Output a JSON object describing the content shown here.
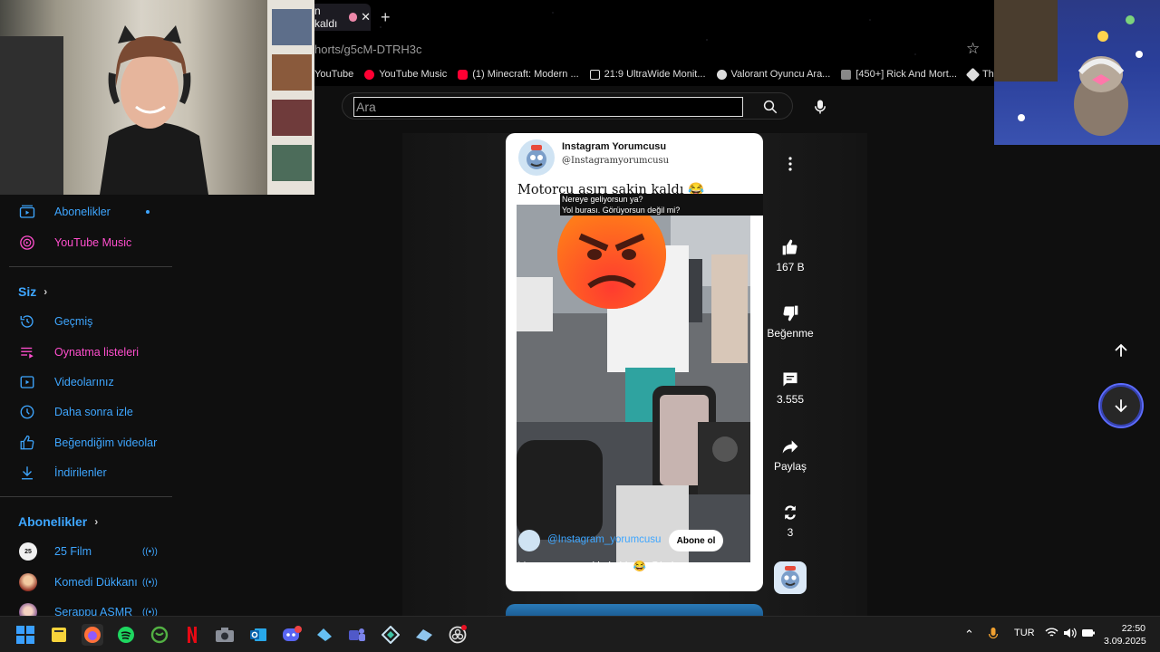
{
  "browser": {
    "tab_title": "n kaldı",
    "tab_close": "✕",
    "new_tab": "+",
    "url": "horts/g5cM-DTRH3c",
    "bookmarks": [
      {
        "label": "YouTube",
        "color": "#000000"
      },
      {
        "label": "YouTube Music",
        "color": "#ff0033"
      },
      {
        "label": "(1) Minecraft: Modern ...",
        "color": "#ff0033"
      },
      {
        "label": "21:9 UltraWide Monit...",
        "color": "#dddddd"
      },
      {
        "label": "Valorant Oyuncu Ara...",
        "color": "#dddddd"
      },
      {
        "label": "[450+] Rick And Mort...",
        "color": "#888888"
      },
      {
        "label": "The best Chat",
        "color": "#dddddd"
      }
    ]
  },
  "search": {
    "placeholder": "Ara"
  },
  "sidebar": {
    "top_items": [
      {
        "label": "Abonelikler",
        "icon": "subscriptions-icon"
      },
      {
        "label": "YouTube Music",
        "icon": "youtube-music-icon"
      }
    ],
    "you_header": "Siz",
    "you_items": [
      {
        "label": "Geçmiş",
        "icon": "history-icon"
      },
      {
        "label": "Oynatma listeleri",
        "icon": "playlists-icon"
      },
      {
        "label": "Videolarınız",
        "icon": "your-videos-icon"
      },
      {
        "label": "Daha sonra izle",
        "icon": "watch-later-icon"
      },
      {
        "label": "Beğendiğim videolar",
        "icon": "liked-videos-icon"
      },
      {
        "label": "İndirilenler",
        "icon": "downloads-icon"
      }
    ],
    "subs_header": "Abonelikler",
    "channels": [
      {
        "label": "25 Film",
        "color": "#f0f0f0"
      },
      {
        "label": "Komedi Dükkanı",
        "color": "#c0392b"
      },
      {
        "label": "Serappu ASMR",
        "color": "#b06ab3"
      }
    ]
  },
  "short": {
    "channel_name": "Instagram Yorumcusu",
    "channel_handle": "@Instagramyorumcusu",
    "title": "Motorcu aşırı sakin kaldı 😂",
    "subtitle_line1": "Nereye geliyorsun ya?",
    "subtitle_line2": "Yol burası. Görüyorsun değil mi?",
    "overlay_handle": "@Instagram_yorumcusu",
    "subscribe_label": "Abone ol",
    "caption": "Motorcu aşırı sakin kaldı 😂 @bahawave"
  },
  "actions": {
    "like_count": "167 B",
    "dislike_label": "Beğenme",
    "comment_count": "3.555",
    "share_label": "Paylaş",
    "remix_count": "3"
  },
  "taskbar": {
    "apps": [
      "windows-start-icon",
      "file-explorer-icon",
      "firefox-icon",
      "spotify-icon",
      "xbox-icon",
      "netflix-icon",
      "camera-icon",
      "outlook-icon",
      "discord-icon",
      "steam-icon",
      "teams-icon",
      "vpn-icon",
      "steam-alt-icon",
      "obs-icon"
    ],
    "language": "TUR",
    "time": "22:50",
    "date": "3.09.2025"
  }
}
